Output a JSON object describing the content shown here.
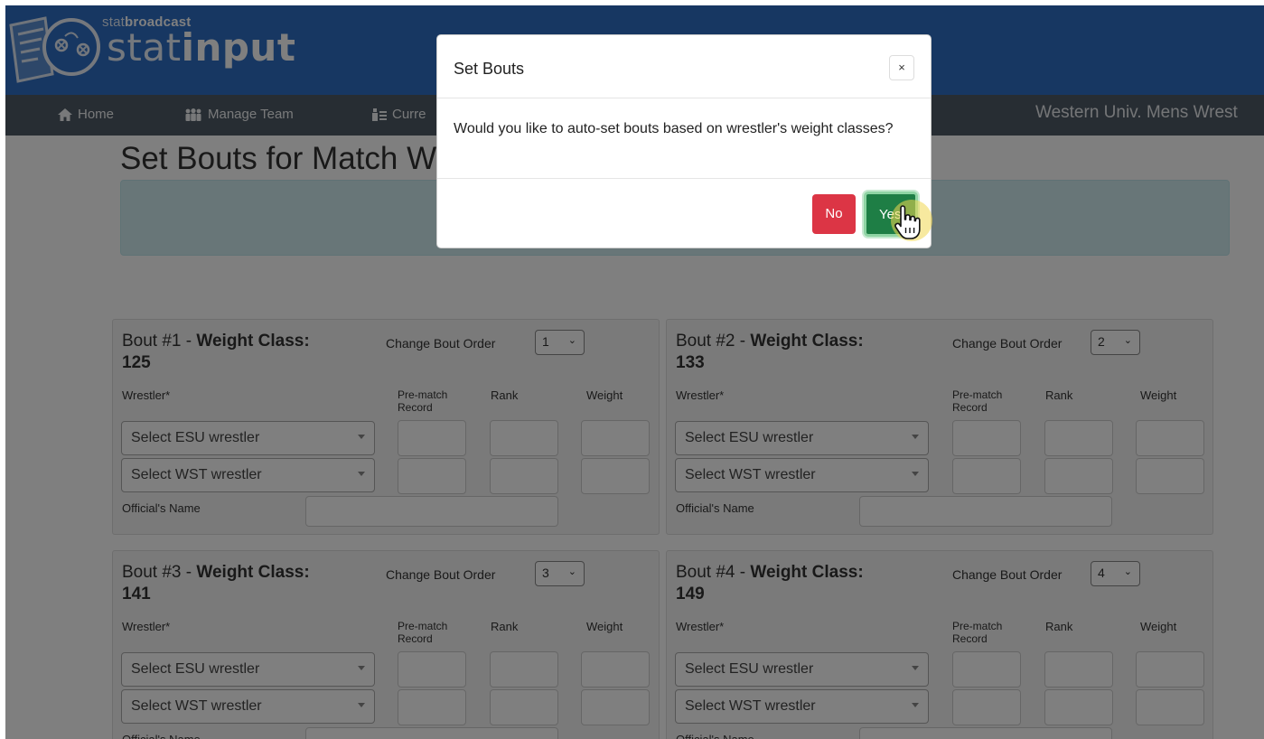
{
  "header": {
    "brand_prefix_light": "stat",
    "brand_prefix_bold": "broadcast",
    "brand_main_light": "stat",
    "brand_main_bold": "input"
  },
  "nav": {
    "items": [
      {
        "label": "Home",
        "icon": "home-icon"
      },
      {
        "label": "Manage Team",
        "icon": "team-icon"
      },
      {
        "label": "Curre",
        "icon": "current-icon"
      }
    ],
    "team_title": "Western Univ. Mens Wrest"
  },
  "page": {
    "title": "Set Bouts for Match W"
  },
  "bouts": [
    {
      "prefix": "Bout #1 - ",
      "weight_label": "Weight Class:",
      "weight": "125",
      "order": "1"
    },
    {
      "prefix": "Bout #2 - ",
      "weight_label": "Weight Class:",
      "weight": "133",
      "order": "2"
    },
    {
      "prefix": "Bout #3 - ",
      "weight_label": "Weight Class:",
      "weight": "141",
      "order": "3"
    },
    {
      "prefix": "Bout #4 - ",
      "weight_label": "Weight Class:",
      "weight": "149",
      "order": "4"
    }
  ],
  "bout_labels": {
    "change_order": "Change Bout Order",
    "wrestler": "Wrestler*",
    "pre_match": "Pre-match",
    "record": "Record",
    "rank": "Rank",
    "weight": "Weight",
    "official": "Official's Name",
    "esu_placeholder": "Select ESU wrestler",
    "wst_placeholder": "Select WST wrestler"
  },
  "modal": {
    "title": "Set Bouts",
    "close": "×",
    "body": "Would you like to auto-set bouts based on wrestler's weight classes?",
    "no_label": "No",
    "yes_label": "Yes"
  },
  "colors": {
    "header_blue": "#2f6ec4",
    "nav_gray": "#4f5b66",
    "danger": "#dc3545",
    "success": "#1e7e45"
  }
}
